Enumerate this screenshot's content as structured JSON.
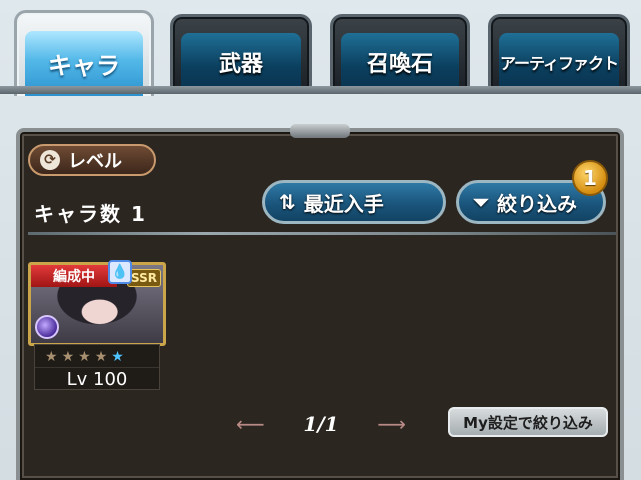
{
  "tabs": [
    {
      "label": "キャラ",
      "active": true
    },
    {
      "label": "武器",
      "active": false
    },
    {
      "label": "召喚石",
      "active": false
    },
    {
      "label": "アーティファクト",
      "active": false
    }
  ],
  "sort": {
    "label": "レベル",
    "icon": "cycle-icon"
  },
  "count": {
    "label": "キャラ数",
    "value": "1"
  },
  "buttons": {
    "recent": {
      "label": "最近入手",
      "icon": "sort-arrows-icon"
    },
    "filter": {
      "label": "絞り込み",
      "icon": "filter-funnel-icon"
    }
  },
  "filter_badge": "1",
  "card": {
    "status": "編成中",
    "rarity": "SSR",
    "element_icon": "water-drop-icon",
    "stars_filled": 4,
    "stars_total": 5,
    "level_label": "Lv",
    "level": "100"
  },
  "pager": {
    "text": "1/1"
  },
  "preset_button": "My設定で絞り込み"
}
